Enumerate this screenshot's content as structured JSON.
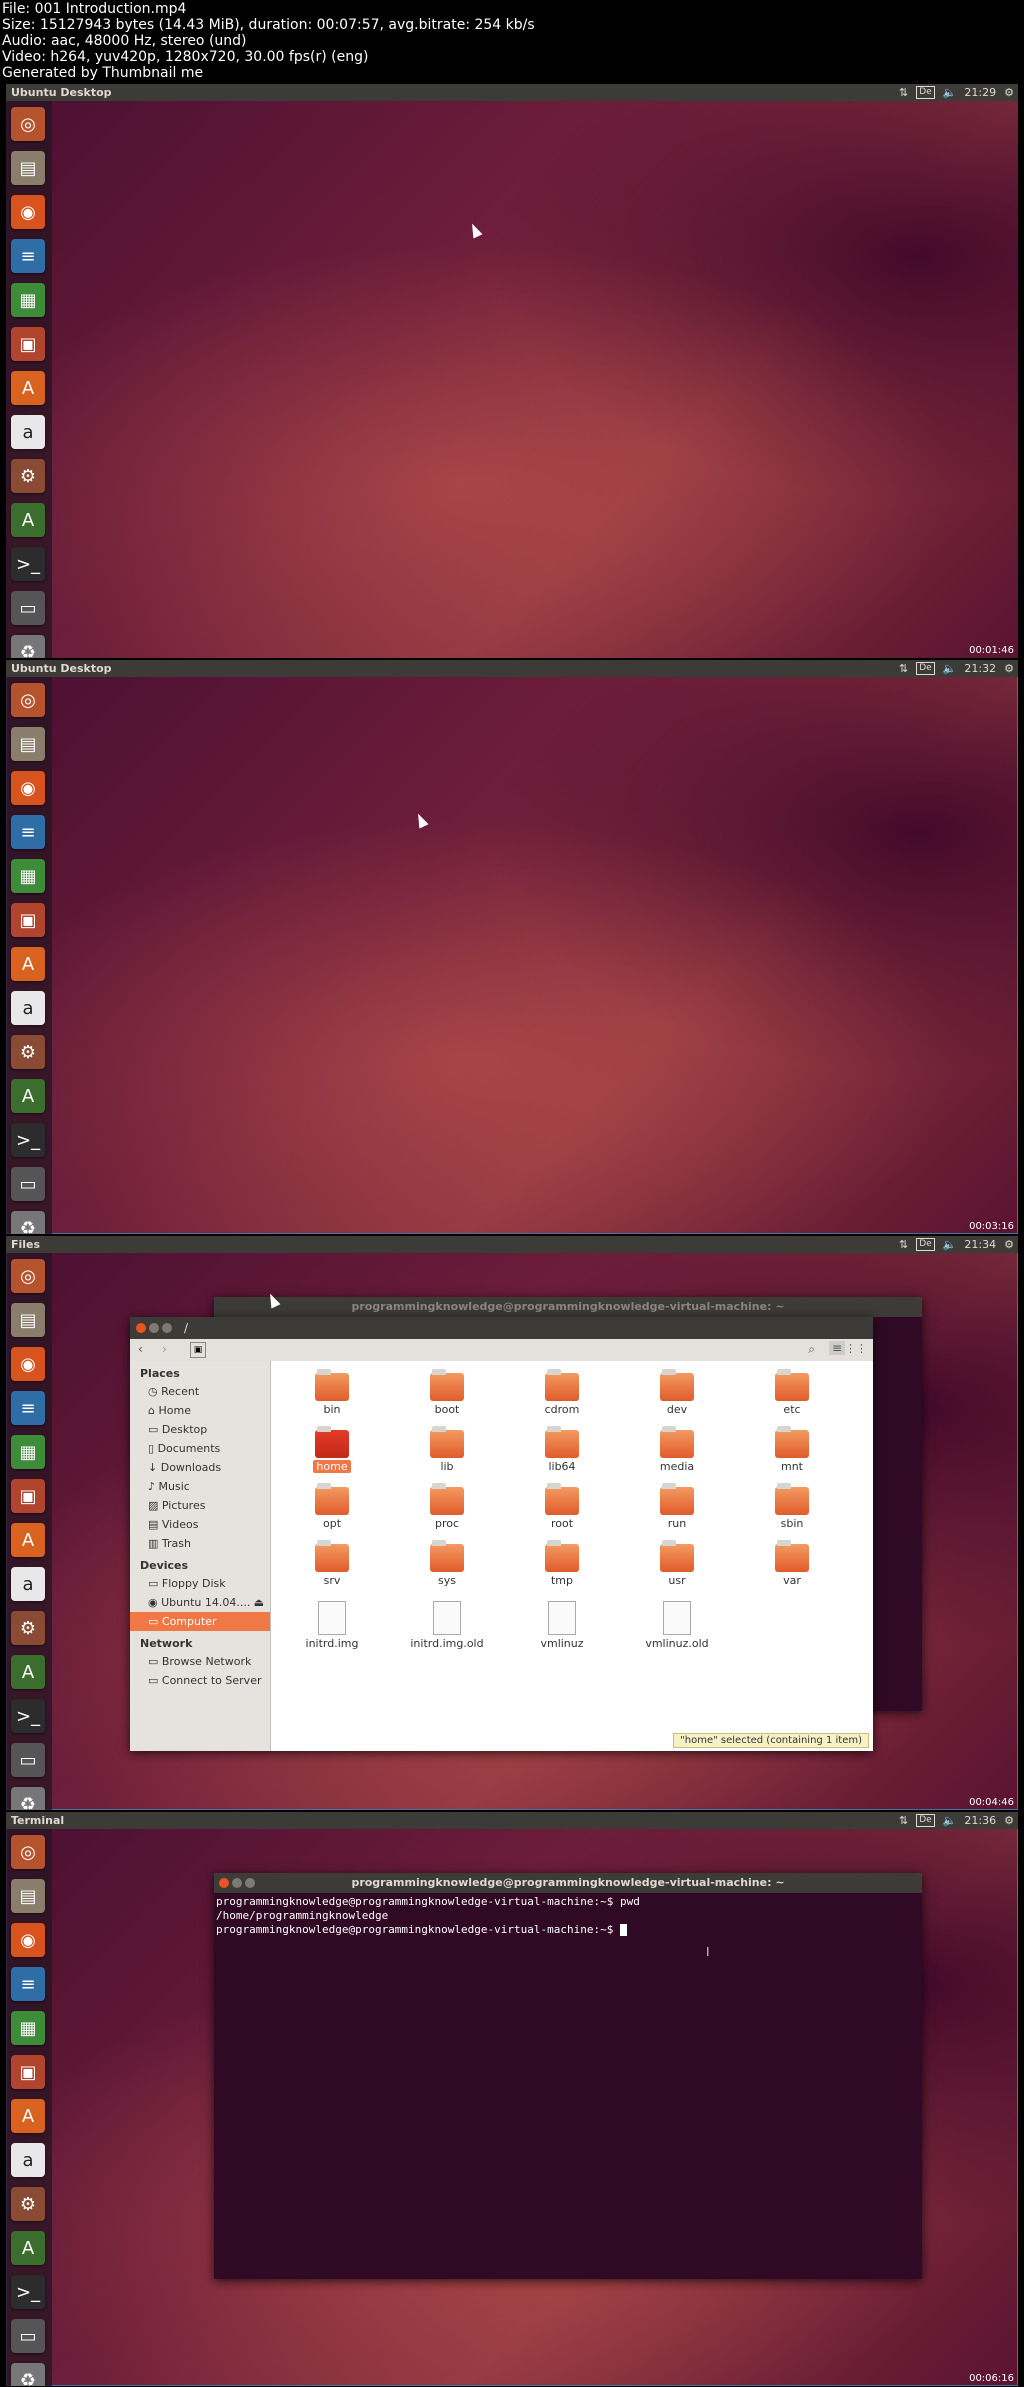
{
  "info": {
    "line1": "File: 001 Introduction.mp4",
    "line2": "Size: 15127943 bytes (14.43 MiB), duration: 00:07:57, avg.bitrate: 254 kb/s",
    "line3": "Audio: aac, 48000 Hz, stereo (und)",
    "line4": "Video: h264, yuv420p, 1280x720, 30.00 fps(r) (eng)",
    "line5": "Generated by Thumbnail me"
  },
  "frames": [
    {
      "title": "Ubuntu Desktop",
      "clock": "21:29",
      "timestamp": "00:01:46"
    },
    {
      "title": "Ubuntu Desktop",
      "clock": "21:32",
      "timestamp": "00:03:16"
    },
    {
      "title": "Files",
      "clock": "21:34",
      "timestamp": "00:04:46"
    },
    {
      "title": "Terminal",
      "clock": "21:36",
      "timestamp": "00:06:16"
    }
  ],
  "tray": {
    "box": "De"
  },
  "files": {
    "path": "/",
    "background_terminal_title": "programmingknowledge@programmingknowledge-virtual-machine: ~",
    "places_header": "Places",
    "places": [
      "Recent",
      "Home",
      "Desktop",
      "Documents",
      "Downloads",
      "Music",
      "Pictures",
      "Videos",
      "Trash"
    ],
    "devices_header": "Devices",
    "devices": [
      "Floppy Disk",
      "Ubuntu 14.04....",
      "Computer"
    ],
    "network_header": "Network",
    "network": [
      "Browse Network",
      "Connect to Server"
    ],
    "items": [
      "bin",
      "boot",
      "cdrom",
      "dev",
      "etc",
      "home",
      "lib",
      "lib64",
      "media",
      "mnt",
      "opt",
      "proc",
      "root",
      "run",
      "sbin",
      "srv",
      "sys",
      "tmp",
      "usr",
      "var",
      "initrd.img",
      "initrd.img.old",
      "vmlinuz",
      "vmlinuz.old"
    ],
    "status": "\"home\" selected (containing 1 item)"
  },
  "terminal": {
    "title": "programmingknowledge@programmingknowledge-virtual-machine: ~",
    "line1": "programmingknowledge@programmingknowledge-virtual-machine:~$ pwd",
    "line2": "/home/programmingknowledge",
    "line3": "programmingknowledge@programmingknowledge-virtual-machine:~$ "
  },
  "launcher_icons": [
    "dash-icon",
    "files-icon",
    "firefox-icon",
    "writer-icon",
    "calc-icon",
    "impress-icon",
    "software-center-icon",
    "amazon-icon",
    "settings-icon",
    "updater-icon",
    "terminal-icon",
    "disk-icon",
    "trash-icon"
  ],
  "colors": {
    "accent": "#f07746",
    "panel": "#3c3b37",
    "terminal_bg": "#300a24"
  }
}
